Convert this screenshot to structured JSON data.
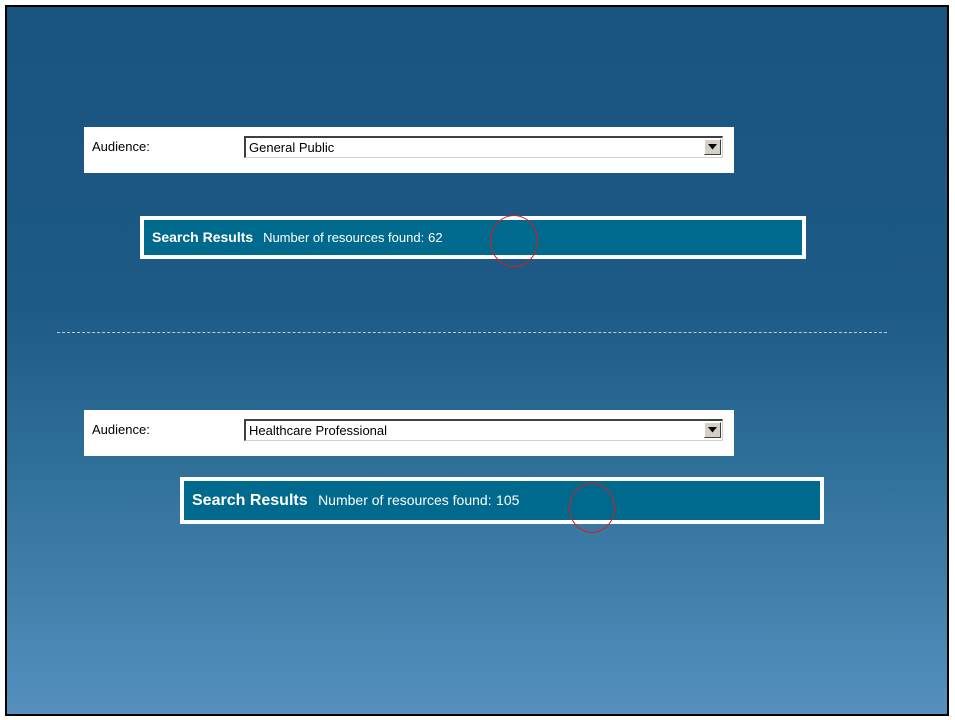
{
  "top_example": {
    "audience_label": "Audience:",
    "audience_value": "General Public",
    "results_title": "Search Results",
    "results_text": "Number of resources found:",
    "results_count": "62"
  },
  "bottom_example": {
    "audience_label": "Audience:",
    "audience_value": "Healthcare Professional",
    "results_title": "Search Results",
    "results_text": "Number of resources found:",
    "results_count": "105"
  },
  "colors": {
    "background_top": "#1a5480",
    "background_bottom": "#5590be",
    "results_bar": "#006a8e",
    "highlight_circle": "#e0191e"
  },
  "icons": [
    "dropdown-arrow-icon",
    "highlight-circle"
  ]
}
